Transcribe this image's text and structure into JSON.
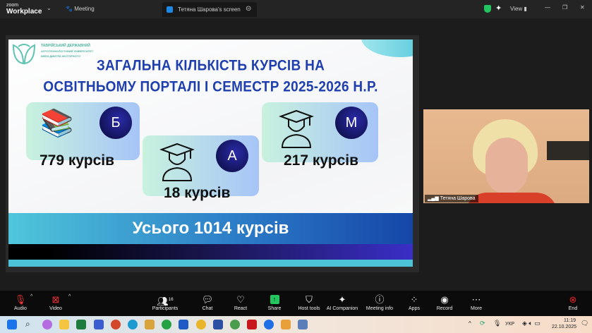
{
  "app": {
    "brand_small": "zoom",
    "brand": "Workplace",
    "meeting_tab": "Meeting",
    "screen_tab": "Тетяна Шарова's screen",
    "view_label": "View"
  },
  "slide": {
    "logo_text": [
      "ТАВРІЙСЬКИЙ ДЕРЖАВНИЙ",
      "АГРОТЕХНОЛОГІЧНИЙ УНІВЕРСИТЕТ",
      "ІМЕНІ ДМИТРА МОТОРНОГО"
    ],
    "title_line1": "ЗАГАЛЬНА КІЛЬКІСТЬ КУРСІВ НА",
    "title_line2": "ОСВІТНЬОМУ ПОРТАЛІ І СЕМЕСТР 2025-2026 Н.Р.",
    "cards": [
      {
        "badge": "Б",
        "count": "779 курсів",
        "icon": "books-icon"
      },
      {
        "badge": "А",
        "count": "18 курсів",
        "icon": "graduate-icon"
      },
      {
        "badge": "М",
        "count": "217 курсів",
        "icon": "graduate-icon"
      }
    ],
    "total": "Усього 1014 курсів"
  },
  "video": {
    "participant_name": "Тетяна Шарова"
  },
  "toolbar": {
    "audio": "Audio",
    "video": "Video",
    "participants": "Participants",
    "participants_count": "16",
    "chat": "Chat",
    "react": "React",
    "share": "Share",
    "host_tools": "Host tools",
    "ai_companion": "AI Companion",
    "meeting_info": "Meeting info",
    "apps": "Apps",
    "record": "Record",
    "more": "More",
    "end": "End"
  },
  "taskbar": {
    "lang": "УКР",
    "time": "11:19",
    "date": "22.10.2025"
  },
  "colors": {
    "title": "#1f3fae",
    "share_green": "#22c55e",
    "end_red": "#e02424"
  }
}
